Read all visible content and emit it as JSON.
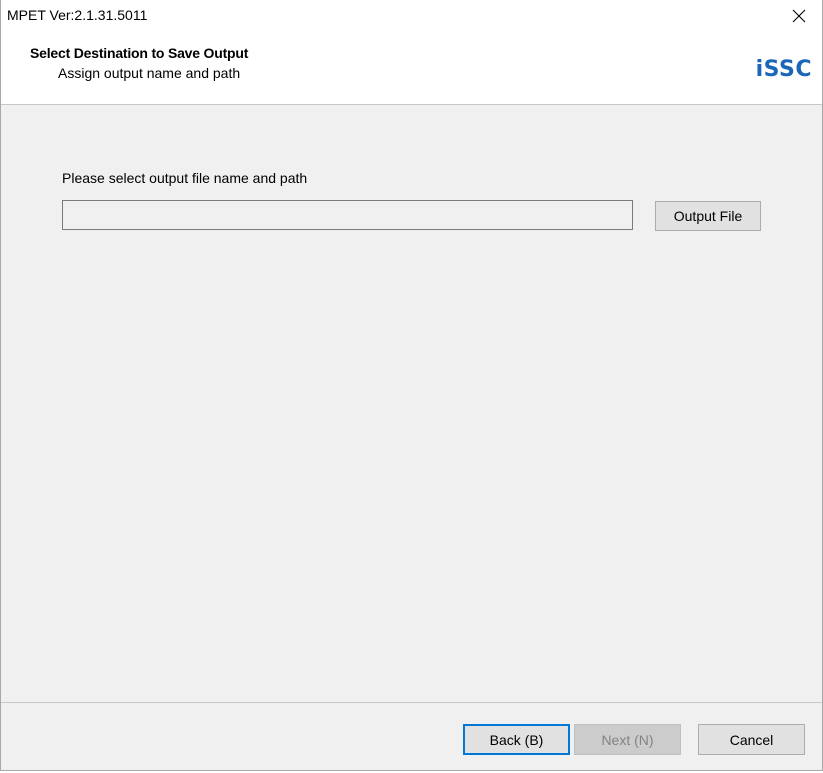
{
  "window": {
    "title": "MPET Ver:2.1.31.5011",
    "close_icon": "close-icon"
  },
  "header": {
    "title": "Select Destination to Save Output",
    "subtitle": "Assign output name and path",
    "logo_text": "ISSC",
    "logo_color": "#1a66b8"
  },
  "main": {
    "prompt": "Please select output file name and path",
    "output_path": {
      "value": "",
      "placeholder": ""
    },
    "output_file_button": "Output File"
  },
  "footer": {
    "back_button": "Back (B)",
    "next_button": "Next (N)",
    "next_enabled": false,
    "cancel_button": "Cancel",
    "focus_color": "#0078d7"
  }
}
